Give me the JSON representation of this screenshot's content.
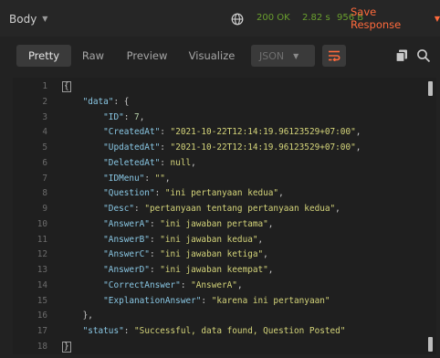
{
  "colors": {
    "status_ok": "#6a9f2e",
    "accent": "#ff6a3c",
    "key": "#89c7e4",
    "string": "#d4d47a",
    "number": "#b5cea8"
  },
  "header": {
    "body_label": "Body",
    "status": "200 OK",
    "time": "2.82 s",
    "size": "956 B",
    "save_response_label": "Save Response"
  },
  "toolbar": {
    "tabs": [
      "Pretty",
      "Raw",
      "Preview",
      "Visualize"
    ],
    "format": "JSON"
  },
  "editor": {
    "line_numbers": [
      "1",
      "2",
      "3",
      "4",
      "5",
      "6",
      "7",
      "8",
      "9",
      "10",
      "11",
      "12",
      "13",
      "14",
      "15",
      "16",
      "17",
      "18"
    ],
    "lines": [
      {
        "parts": [
          {
            "t": "{",
            "c": "tok-punct bracket-box"
          }
        ]
      },
      {
        "parts": [
          {
            "t": "    ",
            "c": ""
          },
          {
            "t": "\"data\"",
            "c": "tok-key"
          },
          {
            "t": ": {",
            "c": "tok-punct"
          }
        ]
      },
      {
        "parts": [
          {
            "t": "        ",
            "c": ""
          },
          {
            "t": "\"ID\"",
            "c": "tok-key"
          },
          {
            "t": ": ",
            "c": "tok-punct"
          },
          {
            "t": "7",
            "c": "tok-num"
          },
          {
            "t": ",",
            "c": "tok-punct"
          }
        ]
      },
      {
        "parts": [
          {
            "t": "        ",
            "c": ""
          },
          {
            "t": "\"CreatedAt\"",
            "c": "tok-key"
          },
          {
            "t": ": ",
            "c": "tok-punct"
          },
          {
            "t": "\"2021-10-22T12:14:19.96123529+07:00\"",
            "c": "tok-str"
          },
          {
            "t": ",",
            "c": "tok-punct"
          }
        ]
      },
      {
        "parts": [
          {
            "t": "        ",
            "c": ""
          },
          {
            "t": "\"UpdatedAt\"",
            "c": "tok-key"
          },
          {
            "t": ": ",
            "c": "tok-punct"
          },
          {
            "t": "\"2021-10-22T12:14:19.96123529+07:00\"",
            "c": "tok-str"
          },
          {
            "t": ",",
            "c": "tok-punct"
          }
        ]
      },
      {
        "parts": [
          {
            "t": "        ",
            "c": ""
          },
          {
            "t": "\"DeletedAt\"",
            "c": "tok-key"
          },
          {
            "t": ": ",
            "c": "tok-punct"
          },
          {
            "t": "null",
            "c": "tok-null"
          },
          {
            "t": ",",
            "c": "tok-punct"
          }
        ]
      },
      {
        "parts": [
          {
            "t": "        ",
            "c": ""
          },
          {
            "t": "\"IDMenu\"",
            "c": "tok-key"
          },
          {
            "t": ": ",
            "c": "tok-punct"
          },
          {
            "t": "\"\"",
            "c": "tok-str"
          },
          {
            "t": ",",
            "c": "tok-punct"
          }
        ]
      },
      {
        "parts": [
          {
            "t": "        ",
            "c": ""
          },
          {
            "t": "\"Question\"",
            "c": "tok-key"
          },
          {
            "t": ": ",
            "c": "tok-punct"
          },
          {
            "t": "\"ini pertanyaan kedua\"",
            "c": "tok-str"
          },
          {
            "t": ",",
            "c": "tok-punct"
          }
        ]
      },
      {
        "parts": [
          {
            "t": "        ",
            "c": ""
          },
          {
            "t": "\"Desc\"",
            "c": "tok-key"
          },
          {
            "t": ": ",
            "c": "tok-punct"
          },
          {
            "t": "\"pertanyaan tentang pertanyaan kedua\"",
            "c": "tok-str"
          },
          {
            "t": ",",
            "c": "tok-punct"
          }
        ]
      },
      {
        "parts": [
          {
            "t": "        ",
            "c": ""
          },
          {
            "t": "\"AnswerA\"",
            "c": "tok-key"
          },
          {
            "t": ": ",
            "c": "tok-punct"
          },
          {
            "t": "\"ini jawaban pertama\"",
            "c": "tok-str"
          },
          {
            "t": ",",
            "c": "tok-punct"
          }
        ]
      },
      {
        "parts": [
          {
            "t": "        ",
            "c": ""
          },
          {
            "t": "\"AnswerB\"",
            "c": "tok-key"
          },
          {
            "t": ": ",
            "c": "tok-punct"
          },
          {
            "t": "\"ini jawaban kedua\"",
            "c": "tok-str"
          },
          {
            "t": ",",
            "c": "tok-punct"
          }
        ]
      },
      {
        "parts": [
          {
            "t": "        ",
            "c": ""
          },
          {
            "t": "\"AnswerC\"",
            "c": "tok-key"
          },
          {
            "t": ": ",
            "c": "tok-punct"
          },
          {
            "t": "\"ini jawaban ketiga\"",
            "c": "tok-str"
          },
          {
            "t": ",",
            "c": "tok-punct"
          }
        ]
      },
      {
        "parts": [
          {
            "t": "        ",
            "c": ""
          },
          {
            "t": "\"AnswerD\"",
            "c": "tok-key"
          },
          {
            "t": ": ",
            "c": "tok-punct"
          },
          {
            "t": "\"ini jawaban keempat\"",
            "c": "tok-str"
          },
          {
            "t": ",",
            "c": "tok-punct"
          }
        ]
      },
      {
        "parts": [
          {
            "t": "        ",
            "c": ""
          },
          {
            "t": "\"CorrectAnswer\"",
            "c": "tok-key"
          },
          {
            "t": ": ",
            "c": "tok-punct"
          },
          {
            "t": "\"AnswerA\"",
            "c": "tok-str"
          },
          {
            "t": ",",
            "c": "tok-punct"
          }
        ]
      },
      {
        "parts": [
          {
            "t": "        ",
            "c": ""
          },
          {
            "t": "\"ExplanationAnswer\"",
            "c": "tok-key"
          },
          {
            "t": ": ",
            "c": "tok-punct"
          },
          {
            "t": "\"karena ini pertanyaan\"",
            "c": "tok-str"
          }
        ]
      },
      {
        "parts": [
          {
            "t": "    ",
            "c": ""
          },
          {
            "t": "},",
            "c": "tok-punct"
          }
        ]
      },
      {
        "parts": [
          {
            "t": "    ",
            "c": ""
          },
          {
            "t": "\"status\"",
            "c": "tok-key"
          },
          {
            "t": ": ",
            "c": "tok-punct"
          },
          {
            "t": "\"Successful, data found, Question Posted\"",
            "c": "tok-str"
          }
        ]
      },
      {
        "parts": [
          {
            "t": "}",
            "c": "tok-punct bracket-box"
          }
        ]
      }
    ]
  }
}
